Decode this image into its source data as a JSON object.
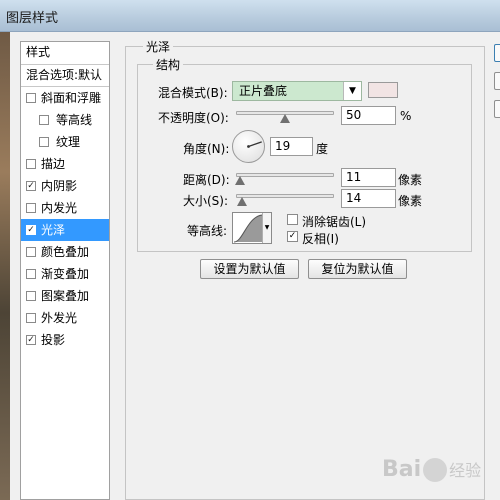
{
  "window": {
    "title": "图层样式"
  },
  "styles_list": {
    "header": "样式",
    "blend_item": "混合选项:默认",
    "items": [
      {
        "label": "斜面和浮雕",
        "checked": false,
        "indent": false,
        "selected": false
      },
      {
        "label": "等高线",
        "checked": false,
        "indent": true,
        "selected": false
      },
      {
        "label": "纹理",
        "checked": false,
        "indent": true,
        "selected": false
      },
      {
        "label": "描边",
        "checked": false,
        "indent": false,
        "selected": false
      },
      {
        "label": "内阴影",
        "checked": true,
        "indent": false,
        "selected": false
      },
      {
        "label": "内发光",
        "checked": false,
        "indent": false,
        "selected": false
      },
      {
        "label": "光泽",
        "checked": true,
        "indent": false,
        "selected": true
      },
      {
        "label": "颜色叠加",
        "checked": false,
        "indent": false,
        "selected": false
      },
      {
        "label": "渐变叠加",
        "checked": false,
        "indent": false,
        "selected": false
      },
      {
        "label": "图案叠加",
        "checked": false,
        "indent": false,
        "selected": false
      },
      {
        "label": "外发光",
        "checked": false,
        "indent": false,
        "selected": false
      },
      {
        "label": "投影",
        "checked": true,
        "indent": false,
        "selected": false
      }
    ]
  },
  "satin": {
    "section_title": "光泽",
    "structure_title": "结构",
    "blend_mode": {
      "label": "混合模式(B):",
      "value": "正片叠底"
    },
    "color": "#f2e4e4",
    "opacity": {
      "label": "不透明度(O):",
      "value": "50",
      "unit": "%",
      "level": 50
    },
    "angle": {
      "label": "角度(N):",
      "value": "19",
      "unit": "度"
    },
    "distance": {
      "label": "距离(D):",
      "value": "11",
      "unit": "像素",
      "level": 4
    },
    "size": {
      "label": "大小(S):",
      "value": "14",
      "unit": "像素",
      "level": 6
    },
    "contour": {
      "label": "等高线:"
    },
    "anti_alias": {
      "label": "消除锯齿(L)",
      "checked": false
    },
    "invert": {
      "label": "反相(I)",
      "checked": true
    }
  },
  "buttons": {
    "make_default": "设置为默认值",
    "reset_default": "复位为默认值"
  },
  "watermark": {
    "text": "Bai",
    "suffix": "经验"
  }
}
